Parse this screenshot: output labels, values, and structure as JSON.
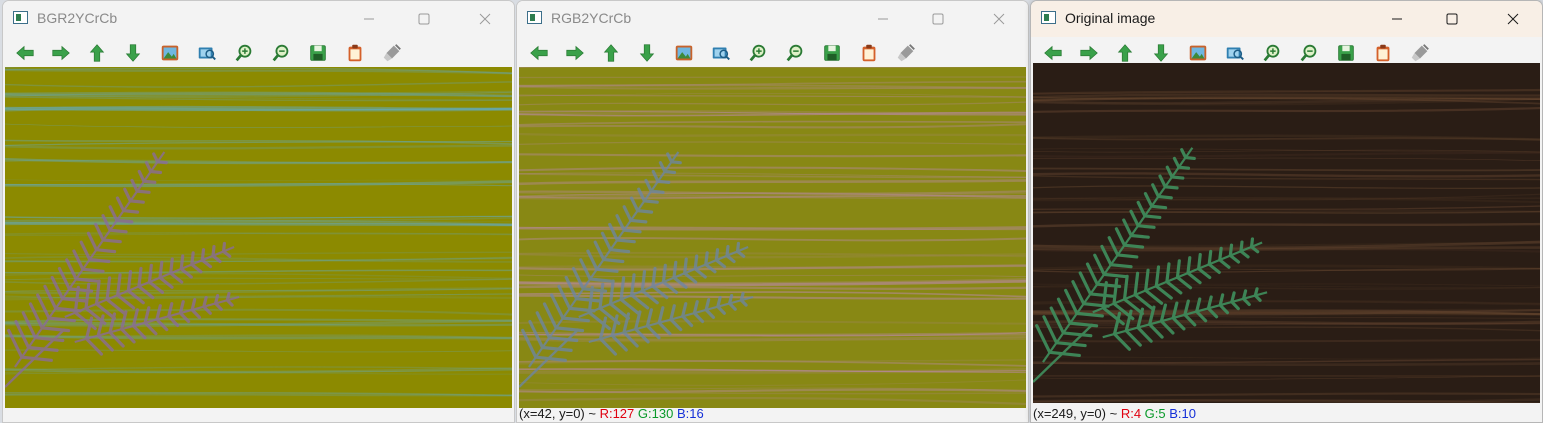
{
  "windows": [
    {
      "title": "BGR2YCrCb",
      "toolbar": [
        "arrow-left-icon",
        "arrow-right-icon",
        "arrow-up-icon",
        "arrow-down-icon",
        "image-icon",
        "zoom-fit-icon",
        "zoom-in-icon",
        "zoom-out-icon",
        "save-icon",
        "copy-icon",
        "settings-brush-icon"
      ],
      "status": {
        "coords": "",
        "r": "",
        "g": "",
        "b": ""
      },
      "colors": {
        "background": "#8c8a00",
        "leaf": "#8a6aa0",
        "grain": "#5faed0"
      }
    },
    {
      "title": "RGB2YCrCb",
      "toolbar": [
        "arrow-left-icon",
        "arrow-right-icon",
        "arrow-up-icon",
        "arrow-down-icon",
        "image-icon",
        "zoom-fit-icon",
        "zoom-in-icon",
        "zoom-out-icon",
        "save-icon",
        "copy-icon",
        "settings-brush-icon"
      ],
      "status": {
        "coords": "(x=42, y=0) ~ ",
        "r": "R:127",
        "g": "G:130",
        "b": "B:16"
      },
      "colors": {
        "background": "#888814",
        "leaf": "#6b86a8",
        "grain": "#c08ab8"
      }
    },
    {
      "title": "Original image",
      "toolbar": [
        "arrow-left-icon",
        "arrow-right-icon",
        "arrow-up-icon",
        "arrow-down-icon",
        "image-icon",
        "zoom-fit-icon",
        "zoom-in-icon",
        "zoom-out-icon",
        "save-icon",
        "copy-icon",
        "settings-brush-icon"
      ],
      "status": {
        "coords": "(x=249, y=0) ~ ",
        "r": "R:4",
        "g": "G:5",
        "b": "B:10"
      },
      "colors": {
        "background": "#2a1d15",
        "leaf": "#3f8a5a",
        "grain": "#6b4a32"
      }
    }
  ]
}
